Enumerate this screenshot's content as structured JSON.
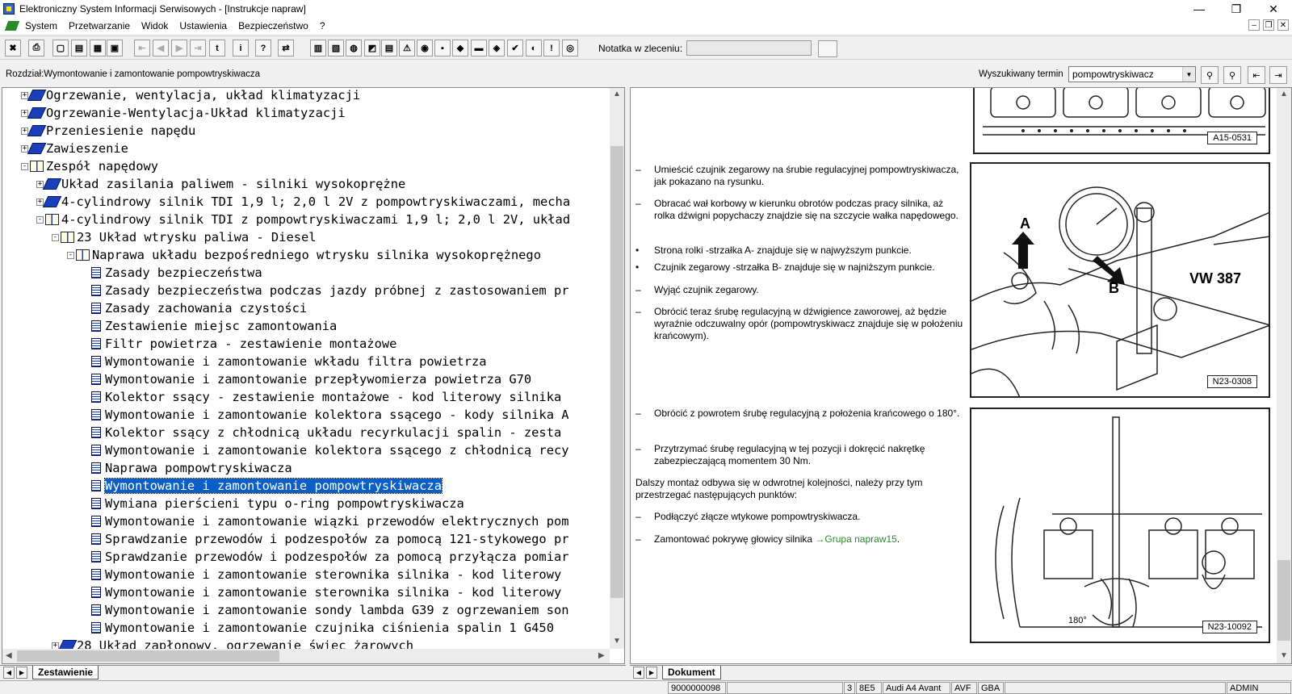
{
  "window": {
    "title": "Elektroniczny System Informacji Serwisowych - [Instrukcje napraw]",
    "minimize": "—",
    "maximize": "❐",
    "close": "✕"
  },
  "menu": [
    "System",
    "Przetwarzanie",
    "Widok",
    "Ustawienia",
    "Bezpieczeństwo",
    "?"
  ],
  "toolbar": {
    "buttons": [
      "✖",
      "⎙",
      "▢",
      "▤",
      "▦",
      "▣",
      "⇤",
      "◀",
      "▶",
      "⇥",
      "t",
      "i",
      "?",
      "⇄",
      "▥",
      "▧",
      "◍",
      "◩",
      "▤",
      "⚠",
      "◉",
      "▪",
      "◆",
      "▬",
      "◈",
      "✔",
      "◐",
      "!",
      "◎"
    ],
    "note_label": "Notatka w zleceniu:",
    "note_value": ""
  },
  "chapter": {
    "text": "Rozdział:Wymontowanie i zamontowanie pompowtryskiwacza"
  },
  "search": {
    "label": "Wyszukiwany termin",
    "value": "pompowtryskiwacz",
    "dd": "▼",
    "buttons": [
      "⚲",
      "⚲",
      "⇤",
      "⇥"
    ]
  },
  "tree": {
    "items": [
      {
        "level": 0,
        "exp": "+",
        "icon": "book",
        "text": "Ogrzewanie, wentylacja, układ klimatyzacji"
      },
      {
        "level": 0,
        "exp": "+",
        "icon": "book",
        "text": "Ogrzewanie-Wentylacja-Układ klimatyzacji"
      },
      {
        "level": 0,
        "exp": "+",
        "icon": "book",
        "text": "Przeniesienie napędu"
      },
      {
        "level": 0,
        "exp": "+",
        "icon": "book",
        "text": "Zawieszenie"
      },
      {
        "level": 0,
        "exp": "-",
        "icon": "open",
        "text": "Zespół napędowy"
      },
      {
        "level": 1,
        "exp": "+",
        "icon": "book",
        "text": "Układ zasilania paliwem - silniki wysokoprężne"
      },
      {
        "level": 1,
        "exp": "+",
        "icon": "book",
        "text": "4-cylindrowy silnik TDI 1,9 l; 2,0 l 2V z pompowtryskiwaczami, mecha"
      },
      {
        "level": 1,
        "exp": "-",
        "icon": "open",
        "text": "4-cylindrowy silnik TDI z pompowtryskiwaczami 1,9 l; 2,0 l 2V, układ"
      },
      {
        "level": 2,
        "exp": "-",
        "icon": "open",
        "text": "23 Układ wtrysku paliwa - Diesel"
      },
      {
        "level": 3,
        "exp": "-",
        "icon": "open",
        "text": "Naprawa układu bezpośredniego wtrysku silnika wysokoprężnego"
      },
      {
        "level": 4,
        "exp": "",
        "icon": "doc",
        "text": "Zasady bezpieczeństwa"
      },
      {
        "level": 4,
        "exp": "",
        "icon": "doc",
        "text": "Zasady bezpieczeństwa podczas jazdy próbnej z zastosowaniem pr"
      },
      {
        "level": 4,
        "exp": "",
        "icon": "doc",
        "text": "Zasady zachowania czystości"
      },
      {
        "level": 4,
        "exp": "",
        "icon": "doc",
        "text": "Zestawienie miejsc zamontowania"
      },
      {
        "level": 4,
        "exp": "",
        "icon": "doc",
        "text": "Filtr powietrza - zestawienie montażowe"
      },
      {
        "level": 4,
        "exp": "",
        "icon": "doc",
        "text": "Wymontowanie i zamontowanie wkładu filtra powietrza"
      },
      {
        "level": 4,
        "exp": "",
        "icon": "doc",
        "text": "Wymontowanie i zamontowanie przepływomierza powietrza G70"
      },
      {
        "level": 4,
        "exp": "",
        "icon": "doc",
        "text": "Kolektor ssący - zestawienie montażowe - kod literowy silnika"
      },
      {
        "level": 4,
        "exp": "",
        "icon": "doc",
        "text": "Wymontowanie i zamontowanie kolektora ssącego - kody silnika A"
      },
      {
        "level": 4,
        "exp": "",
        "icon": "doc",
        "text": "Kolektor ssący z chłodnicą układu recyrkulacji spalin - zesta"
      },
      {
        "level": 4,
        "exp": "",
        "icon": "doc",
        "text": "Wymontowanie i zamontowanie kolektora ssącego z chłodnicą recy"
      },
      {
        "level": 4,
        "exp": "",
        "icon": "doc",
        "text": "Naprawa pompowtryskiwacza"
      },
      {
        "level": 4,
        "exp": "",
        "icon": "doc",
        "text": "Wymontowanie i zamontowanie pompowtryskiwacza",
        "selected": true
      },
      {
        "level": 4,
        "exp": "",
        "icon": "doc",
        "text": "Wymiana pierścieni typu o-ring pompowtryskiwacza"
      },
      {
        "level": 4,
        "exp": "",
        "icon": "doc",
        "text": "Wymontowanie i zamontowanie wiązki przewodów elektrycznych pom"
      },
      {
        "level": 4,
        "exp": "",
        "icon": "doc",
        "text": "Sprawdzanie przewodów i podzespołów za pomocą 121-stykowego pr"
      },
      {
        "level": 4,
        "exp": "",
        "icon": "doc",
        "text": "Sprawdzanie przewodów i podzespołów za pomocą przyłącza pomiar"
      },
      {
        "level": 4,
        "exp": "",
        "icon": "doc",
        "text": "Wymontowanie i zamontowanie sterownika silnika - kod literowy"
      },
      {
        "level": 4,
        "exp": "",
        "icon": "doc",
        "text": "Wymontowanie i zamontowanie sterownika silnika - kod literowy"
      },
      {
        "level": 4,
        "exp": "",
        "icon": "doc",
        "text": "Wymontowanie i zamontowanie sondy lambda G39 z ogrzewaniem son"
      },
      {
        "level": 4,
        "exp": "",
        "icon": "doc",
        "text": "Wymontowanie i zamontowanie czujnika ciśnienia spalin 1 G450"
      },
      {
        "level": 2,
        "exp": "+",
        "icon": "book",
        "text": "28 Układ zapłonowy, ogrzewanie świec żarowych"
      }
    ]
  },
  "left_tab": {
    "label": "Zestawienie"
  },
  "right_tab": {
    "label": "Dokument"
  },
  "document": {
    "steps1": [
      {
        "mk": "–",
        "text": "Umieścić czujnik zegarowy na śrubie regulacyjnej pompowtryskiwacza, jak pokazano na rysunku."
      },
      {
        "mk": "–",
        "text": "Obracać wał korbowy w kierunku obrotów podczas pracy silnika, aż rolka dźwigni popychaczy znajdzie się na szczycie wałka napędowego."
      },
      {
        "mk": "•",
        "text": "Strona rolki -strzałka A- znajduje się w najwyższym punkcie."
      },
      {
        "mk": "•",
        "text": "Czujnik zegarowy -strzałka B- znajduje się w najniższym punkcie."
      },
      {
        "mk": "–",
        "text": "Wyjąć czujnik zegarowy."
      },
      {
        "mk": "–",
        "text": "Obrócić teraz śrubę regulacyjną w dźwigience zaworowej, aż będzie wyraźnie odczuwalny opór (pompowtryskiwacz znajduje się w położeniu krańcowym)."
      }
    ],
    "steps2": [
      {
        "mk": "–",
        "text": "Obrócić z powrotem śrubę regulacyjną z położenia krańcowego o 180°."
      },
      {
        "mk": "–",
        "text": "Przytrzymać śrubę regulacyjną w tej pozycji i dokręcić nakrętkę zabezpieczającą momentem 30 Nm."
      }
    ],
    "paragraph": "Dalszy montaż odbywa się w odwrotnej kolejności, należy przy tym przestrzegać następujących punktów:",
    "steps3": [
      {
        "mk": "–",
        "text": "Podłączyć złącze wtykowe pompowtryskiwacza."
      }
    ],
    "last_step": {
      "mk": "–",
      "text": "Zamontować pokrywę głowicy silnika ",
      "link": "→Grupa napraw15",
      "end": "."
    },
    "figures": [
      {
        "label": "A15-0531"
      },
      {
        "label": "N23-0308",
        "callout_a": "A",
        "callout_b": "B",
        "tool": "VW 387"
      },
      {
        "label": "N23-10092",
        "angle": "180°"
      }
    ]
  },
  "status": {
    "fields": [
      "9000000098",
      "",
      "3",
      "8E5",
      "Audi A4 Avant",
      "AVF",
      "GBA",
      "",
      "ADMIN"
    ]
  }
}
